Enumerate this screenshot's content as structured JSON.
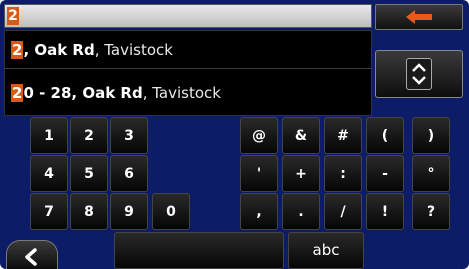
{
  "search": {
    "query": "2"
  },
  "results": [
    {
      "highlight": "2",
      "rest_bold": ", Oak Rd",
      "rest_muted": ", Tavistock"
    },
    {
      "highlight": "2",
      "rest_bold": "0 - 28, Oak Rd",
      "rest_muted": ", Tavistock"
    }
  ],
  "keys": {
    "row1": [
      "1",
      "2",
      "3",
      "@",
      "&",
      "#",
      "(",
      ")"
    ],
    "row2": [
      "4",
      "5",
      "6",
      "'",
      "+",
      ":",
      "-",
      "°"
    ],
    "row3": [
      "7",
      "8",
      "9",
      "0",
      ",",
      ".",
      "/",
      "!",
      "?"
    ],
    "abc_label": "abc"
  },
  "icons": {
    "backspace": "left-arrow-icon",
    "scroll": "up-down-chevron-icon",
    "back": "chevron-left-icon"
  },
  "colors": {
    "background": "#0c1c66",
    "highlight": "#d85a1a"
  }
}
